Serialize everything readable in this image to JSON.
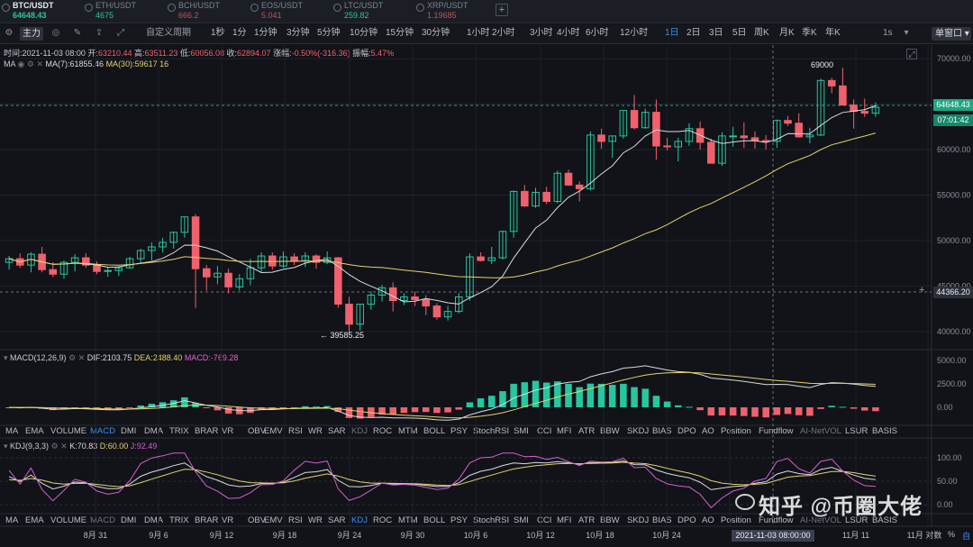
{
  "tickers": [
    {
      "symbol": "BTC/USDT",
      "price": "64648.43",
      "active": true
    },
    {
      "symbol": "ETH/USDT",
      "price": "4675",
      "active": false
    },
    {
      "symbol": "BCH/USDT",
      "price": "666.2",
      "active": false
    },
    {
      "symbol": "EOS/USDT",
      "price": "5.041",
      "active": false
    },
    {
      "symbol": "LTC/USDT",
      "price": "259.82",
      "active": false
    },
    {
      "symbol": "XRP/USDT",
      "price": "1.19685",
      "active": false
    }
  ],
  "ticker_add": "+",
  "toolbar": {
    "main_label": "主力",
    "custom_period": "自定义周期",
    "periods": [
      "1秒",
      "1分",
      "1分钟",
      "3分钟",
      "5分钟",
      "10分钟",
      "15分钟",
      "30分钟",
      "1小时",
      "2小时",
      "3小时",
      "4小时",
      "6小时",
      "12小时",
      "1日",
      "2日",
      "3日",
      "5日",
      "周K",
      "月K",
      "季K",
      "年K"
    ],
    "active_period": "1日",
    "right_1s": "1s",
    "window_btn": "单窗口"
  },
  "candle_info": {
    "time_label": "时间:",
    "time": "2021-11-03 08:00",
    "open_label": "开:",
    "open": "63210.44",
    "high_label": "高:",
    "high": "63511.23",
    "low_label": "低:",
    "low": "60056.08",
    "close_label": "收:",
    "close": "62894.07",
    "change_label": "涨幅:",
    "change": "-0.50%(-316.36)",
    "amp_label": "振幅:",
    "amp": "5.47%"
  },
  "ma": {
    "label": "MA",
    "ma7": "MA(7):61855.46",
    "ma30": "MA(30):59617.16"
  },
  "macd": {
    "label": "MACD(12,26,9)",
    "dif": "DIF:2103.75",
    "dea": "DEA:2488.40",
    "macd": "MACD:-769.28"
  },
  "kdj": {
    "label": "KDJ(9,3,3)",
    "k": "K:70.83",
    "d": "D:60.00",
    "j": "J:92.49"
  },
  "indicators": [
    "MA",
    "EMA",
    "VOLUME",
    "MACD",
    "DMI",
    "DMA",
    "TRIX",
    "BRAR",
    "VR",
    "OBV",
    "EMV",
    "RSI",
    "WR",
    "SAR",
    "KDJ",
    "ROC",
    "MTM",
    "BOLL",
    "PSY",
    "StochRSI",
    "SMI",
    "CCI",
    "MFI",
    "ATR",
    "BBW",
    "SKDJ",
    "BIAS",
    "DPO",
    "AO",
    "Position",
    "Fundflow",
    "AI-NetVOL",
    "LSUR",
    "BASIS"
  ],
  "price_axis": [
    "70000.00",
    "65000.00",
    "60000.00",
    "55000.00",
    "50000.00",
    "45000.00",
    "40000.00"
  ],
  "macd_axis": [
    "5000.00",
    "2500.00",
    "0.00"
  ],
  "kdj_axis": [
    "100.00",
    "50.00",
    "0.00"
  ],
  "date_axis": [
    "8月 31",
    "9月 6",
    "9月 12",
    "9月 18",
    "9月 24",
    "9月 30",
    "10月 6",
    "10月 12",
    "10月 18",
    "10月 24",
    "11月 11",
    "11月 对数"
  ],
  "last_price_tag": "64648.43",
  "countdown_tag": "07:01:42",
  "crosshair_price_tag": "44366.20",
  "crosshair_date_tag": "2021-11-03 08:00:00",
  "annotations": {
    "high": "69000",
    "low": "← 39585.25"
  },
  "watermark": "知乎 @币圈大佬",
  "bottom_pct": "%",
  "bottom_auto": "自",
  "colors": {
    "up": "#26c6a0",
    "down": "#f0616d",
    "ma7": "#d8dbe0",
    "ma30": "#e5d36a",
    "bg": "#111318"
  },
  "chart_data": {
    "type": "candlestick",
    "symbol": "BTC/USDT",
    "interval": "1D",
    "ylim": [
      38000,
      71000
    ],
    "candles": [
      [
        47600,
        48300,
        46800,
        48000
      ],
      [
        48000,
        48600,
        47000,
        47300
      ],
      [
        47300,
        48700,
        46500,
        48500
      ],
      [
        48500,
        49300,
        46500,
        46800
      ],
      [
        46800,
        47600,
        46000,
        46300
      ],
      [
        46300,
        47800,
        45800,
        47600
      ],
      [
        47600,
        48500,
        46600,
        48100
      ],
      [
        48100,
        48600,
        47000,
        47300
      ],
      [
        47300,
        47700,
        46300,
        46600
      ],
      [
        46600,
        47100,
        46000,
        46700
      ],
      [
        46700,
        47200,
        46100,
        47000
      ],
      [
        47000,
        48200,
        46900,
        48000
      ],
      [
        48000,
        49100,
        47600,
        48900
      ],
      [
        48900,
        49800,
        47800,
        49300
      ],
      [
        49300,
        50300,
        48700,
        49800
      ],
      [
        49800,
        51000,
        49100,
        50900
      ],
      [
        50900,
        52600,
        50300,
        52600
      ],
      [
        52600,
        52900,
        42600,
        46900
      ],
      [
        46900,
        47300,
        44500,
        46000
      ],
      [
        46000,
        47200,
        45200,
        46400
      ],
      [
        46400,
        46900,
        44200,
        44900
      ],
      [
        44900,
        46300,
        44500,
        45800
      ],
      [
        45800,
        48000,
        45100,
        47000
      ],
      [
        47000,
        48700,
        46500,
        48300
      ],
      [
        48300,
        48700,
        46800,
        47200
      ],
      [
        47200,
        48800,
        47000,
        48200
      ],
      [
        48200,
        48600,
        47300,
        47800
      ],
      [
        47800,
        48700,
        47100,
        48300
      ],
      [
        48300,
        48500,
        46900,
        47600
      ],
      [
        47600,
        48800,
        47400,
        48100
      ],
      [
        48100,
        48200,
        42600,
        43000
      ],
      [
        43000,
        43800,
        39700,
        40800
      ],
      [
        40800,
        43000,
        40100,
        43000
      ],
      [
        43000,
        44400,
        42400,
        44000
      ],
      [
        44000,
        45100,
        43300,
        44800
      ],
      [
        44800,
        45400,
        42200,
        43400
      ],
      [
        43400,
        44200,
        42900,
        43800
      ],
      [
        43800,
        44400,
        42800,
        43500
      ],
      [
        43500,
        44000,
        41800,
        42800
      ],
      [
        42800,
        43100,
        41300,
        41600
      ],
      [
        41600,
        42800,
        41200,
        42200
      ],
      [
        42200,
        44200,
        42000,
        43800
      ],
      [
        43800,
        48600,
        43400,
        48200
      ],
      [
        48200,
        48700,
        47700,
        47800
      ],
      [
        47800,
        49300,
        47400,
        48100
      ],
      [
        48100,
        51100,
        47900,
        51000
      ],
      [
        51000,
        55500,
        50300,
        55400
      ],
      [
        55400,
        56100,
        53700,
        53800
      ],
      [
        53800,
        55800,
        53600,
        55300
      ],
      [
        55300,
        55900,
        54000,
        54300
      ],
      [
        54300,
        57700,
        54100,
        57400
      ],
      [
        57400,
        57800,
        56000,
        56100
      ],
      [
        56100,
        56500,
        54300,
        55700
      ],
      [
        55700,
        62000,
        55500,
        61600
      ],
      [
        61600,
        62300,
        60100,
        60900
      ],
      [
        60900,
        61500,
        59100,
        61500
      ],
      [
        61500,
        64300,
        61200,
        64300
      ],
      [
        64300,
        66000,
        62200,
        62400
      ],
      [
        62400,
        64500,
        62300,
        64100
      ],
      [
        64100,
        65500,
        58900,
        60400
      ],
      [
        60400,
        61300,
        59900,
        60300
      ],
      [
        60300,
        61300,
        58700,
        60900
      ],
      [
        60900,
        62900,
        60400,
        62300
      ],
      [
        62300,
        63100,
        60000,
        60800
      ],
      [
        60800,
        61200,
        58500,
        58500
      ],
      [
        58500,
        61900,
        58200,
        61500
      ],
      [
        61500,
        62500,
        60300,
        61500
      ],
      [
        61500,
        63000,
        60200,
        61300
      ],
      [
        61300,
        62000,
        60100,
        61000
      ],
      [
        61000,
        61600,
        60000,
        60900
      ],
      [
        60900,
        63300,
        60200,
        63200
      ],
      [
        63200,
        63700,
        62600,
        62900
      ],
      [
        62900,
        64000,
        61300,
        61400
      ],
      [
        61400,
        62400,
        60700,
        61600
      ],
      [
        61600,
        67800,
        61500,
        67600
      ],
      [
        67600,
        67900,
        66200,
        67000
      ],
      [
        67000,
        69000,
        64900,
        64900
      ],
      [
        64900,
        65500,
        62300,
        64200
      ],
      [
        64200,
        65600,
        63600,
        64000
      ],
      [
        64000,
        65200,
        63600,
        64648
      ]
    ]
  }
}
